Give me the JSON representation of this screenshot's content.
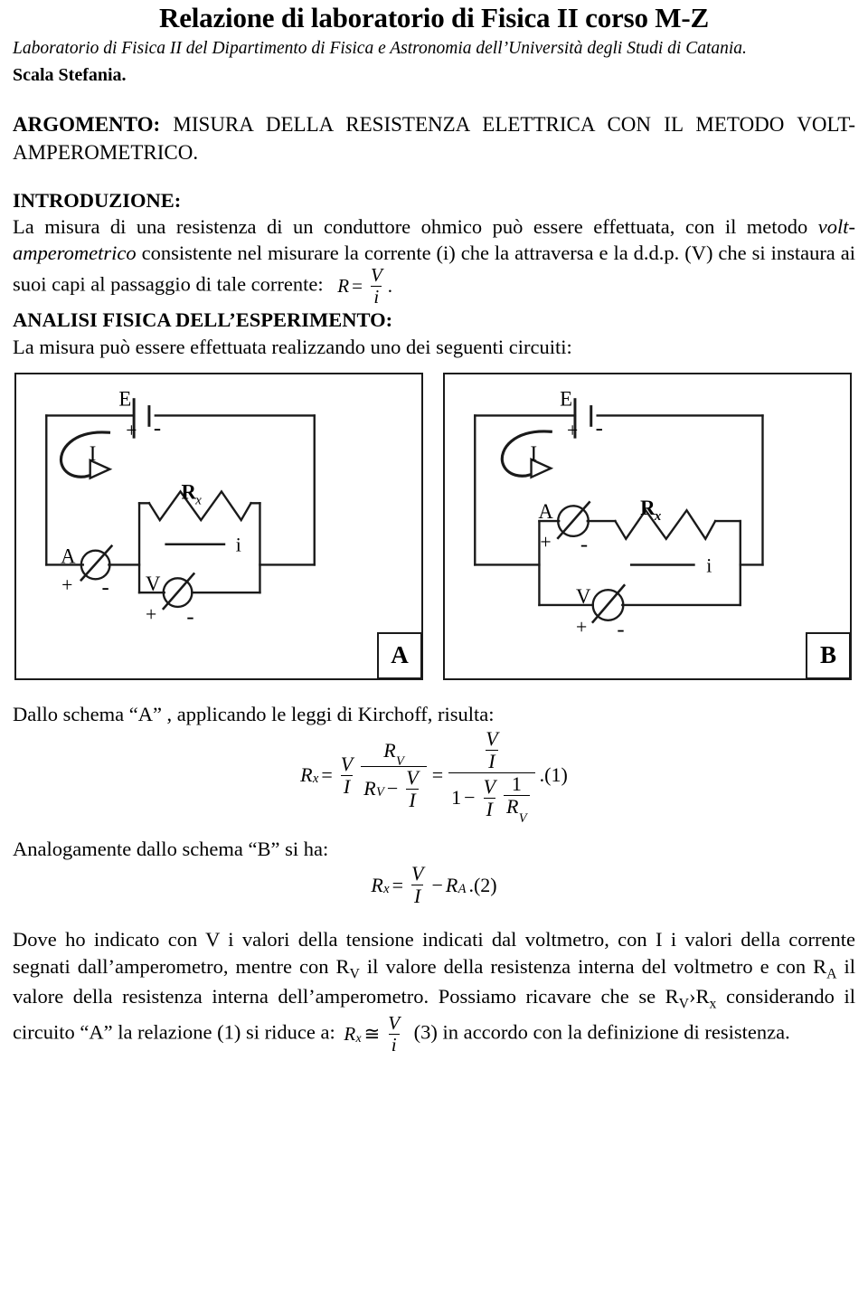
{
  "document": {
    "title": "Relazione di laboratorio di Fisica II corso M-Z",
    "subtitle": "Laboratorio di Fisica II del Dipartimento di Fisica e Astronomia dell’Università degli Studi di Catania.",
    "author": "Scala Stefania."
  },
  "argomento": {
    "label": "ARGOMENTO:",
    "text": "MISURA DELLA RESISTENZA ELETTRICA CON IL METODO VOLT-AMPEROMETRICO."
  },
  "introduzione": {
    "heading": "INTRODUZIONE:",
    "text_part1": "La misura di una resistenza di un conduttore ohmico può essere effettuata, con il metodo ",
    "text_italic": "volt-amperometrico",
    "text_part2": " consistente nel misurare la corrente (i) che la attraversa e la d.d.p. (V) che si instaura ai suoi capi al passaggio di tale corrente:",
    "formula": {
      "lhs": "R",
      "eq": "=",
      "num": "V",
      "den": "i",
      "trail": "."
    }
  },
  "analisi": {
    "heading": "ANALISI FISICA DELL’ESPERIMENTO:",
    "text": "La misura può essere effettuata realizzando uno dei seguenti circuiti:"
  },
  "circuits": [
    {
      "id": "A",
      "corner_label": "A",
      "battery_label": "E",
      "battery_plus": "+",
      "battery_minus": "-",
      "current_label": "I",
      "resistor_label": "R",
      "resistor_sub": "x",
      "resistor_current_label": "i",
      "ammeter_label": "A",
      "ammeter_plus": "+",
      "ammeter_minus": "-",
      "voltmeter_label": "V",
      "voltmeter_plus": "+",
      "voltmeter_minus": "-"
    },
    {
      "id": "B",
      "corner_label": "B",
      "battery_label": "E",
      "battery_plus": "+",
      "battery_minus": "-",
      "current_label": "I",
      "resistor_label": "R",
      "resistor_sub": "x",
      "resistor_current_label": "i",
      "ammeter_label": "A",
      "ammeter_plus": "+",
      "ammeter_minus": "-",
      "voltmeter_label": "V",
      "voltmeter_plus": "+",
      "voltmeter_minus": "-"
    }
  ],
  "schema_a": {
    "intro": "Dallo schema “A” , applicando le leggi di Kirchoff, risulta:",
    "formula": {
      "lhs": "R",
      "lhs_sub": "x",
      "eq1": "=",
      "f1_num": "V",
      "f1_den": "I",
      "f2_num": "R",
      "f2_num_sub": "V",
      "f2_den_left": "R",
      "f2_den_left_sub": "V",
      "f2_den_op": "−",
      "f2_den_num": "V",
      "f2_den_den": "I",
      "eq2": "=",
      "f3_num_num": "V",
      "f3_num_den": "I",
      "f3_den_one": "1",
      "f3_den_op": "−",
      "f3_den_a_num": "V",
      "f3_den_a_den": "I",
      "f3_den_b_num": "1",
      "f3_den_b_den": "R",
      "f3_den_b_den_sub": "V",
      "tag": ".(1)"
    }
  },
  "schema_b": {
    "intro": "Analogamente dallo schema “B” si ha:",
    "formula": {
      "lhs": "R",
      "lhs_sub": "x",
      "eq": "=",
      "num": "V",
      "den": "I",
      "op": "−",
      "ra": "R",
      "ra_sub": "A",
      "tag": ".(2)"
    }
  },
  "conclusione": {
    "line1": "Dove ho indicato con V i valori della tensione indicati dal voltmetro, con I i valori della corrente segnati dall’amperometro, mentre con R",
    "rv_sub_1": "V",
    "line2": " il valore della resistenza interna del voltmetro e con R",
    "ra_sub_1": "A",
    "line3": " il valore della resistenza interna dell’amperometro.",
    "line4": "Possiamo ricavare che se R",
    "rv_sub_2": "V",
    "line5": "›R",
    "rx_sub_2": "x",
    "line6": " considerando il circuito “A” la relazione (1)  si riduce a:",
    "formula": {
      "lhs": "R",
      "lhs_sub": "x",
      "eq": "≅",
      "num": "V",
      "den": "i"
    },
    "line7": " (3) in accordo con la definizione di resistenza."
  },
  "colors": {
    "ink": "#000000",
    "line": "#1a1a1a",
    "page_bg": "#ffffff"
  }
}
